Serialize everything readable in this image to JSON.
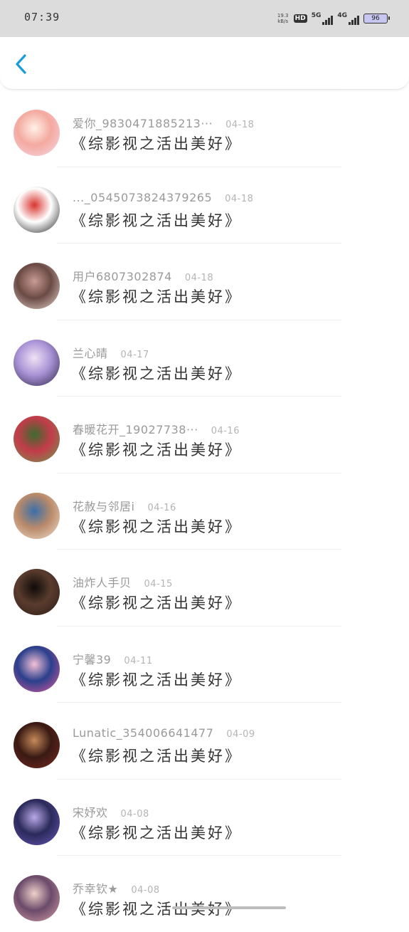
{
  "status_bar": {
    "time": "07:39",
    "net_speed": "19.3\nkB/s",
    "hd_label": "HD",
    "signal_5g": "5G",
    "signal_4g": "4G",
    "battery": "96"
  },
  "header": {
    "back_icon": "chevron-left-icon",
    "accent_color": "#1a9bdc"
  },
  "comments": [
    {
      "username": "爱你_9830471885213···",
      "date": "04-18",
      "text": "《综影视之活出美好》",
      "avatar_colors": [
        "#f7d9e6",
        "#f4a9a0",
        "#fff1e6"
      ]
    },
    {
      "username": "..._0545073824379265",
      "date": "04-18",
      "text": "《综影视之活出美好》",
      "avatar_colors": [
        "#1b1b1b",
        "#ffffff",
        "#d8352f"
      ]
    },
    {
      "username": "用户6807302874",
      "date": "04-18",
      "text": "《综影视之活出美好》",
      "avatar_colors": [
        "#e9d6d0",
        "#6b4a44",
        "#c89c94"
      ]
    },
    {
      "username": "兰心晴",
      "date": "04-17",
      "text": "《综影视之活出美好》",
      "avatar_colors": [
        "#2c2346",
        "#a993d6",
        "#f0e2f4"
      ]
    },
    {
      "username": "春暖花开_19027738···",
      "date": "04-16",
      "text": "《综影视之活出美好》",
      "avatar_colors": [
        "#6f9a4e",
        "#c33c4a",
        "#3d6a2e"
      ]
    },
    {
      "username": "花赦与邻居i",
      "date": "04-16",
      "text": "《综影视之活出美好》",
      "avatar_colors": [
        "#f1dfcf",
        "#b98a6a",
        "#3a6fa8"
      ]
    },
    {
      "username": "油炸人手贝",
      "date": "04-15",
      "text": "《综影视之活出美好》",
      "avatar_colors": [
        "#2b1b16",
        "#5a3c2e",
        "#0f0b09"
      ]
    },
    {
      "username": "宁馨39",
      "date": "04-11",
      "text": "《综影视之活出美好》",
      "avatar_colors": [
        "#e25a9b",
        "#2a3f8c",
        "#f4c0d6"
      ]
    },
    {
      "username": "Lunatic_354006641477",
      "date": "04-09",
      "text": "《综影视之活出美好》",
      "avatar_colors": [
        "#7a2a22",
        "#3a1a14",
        "#c58a5a"
      ]
    },
    {
      "username": "宋妤欢",
      "date": "04-08",
      "text": "《综影视之活出美好》",
      "avatar_colors": [
        "#6a57b8",
        "#2a2a5a",
        "#b9a8e8"
      ]
    },
    {
      "username": "乔幸钦★",
      "date": "04-08",
      "text": "《综影视之活出美好》",
      "avatar_colors": [
        "#d9a0a8",
        "#6a4a6a",
        "#f0d0c8"
      ]
    }
  ]
}
